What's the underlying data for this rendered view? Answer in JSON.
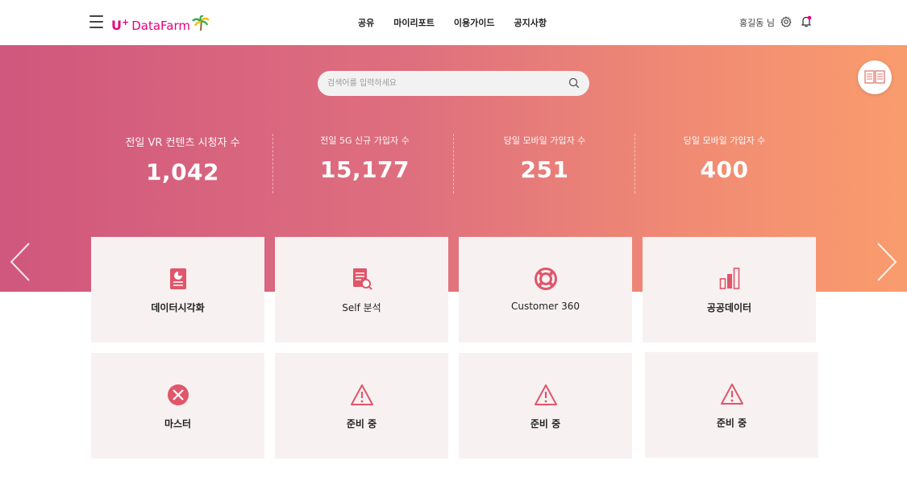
{
  "header": {
    "logo_u": "U",
    "logo_plus": "+",
    "logo_data": "Data",
    "logo_farm": "Farm",
    "nav": [
      "공유",
      "마이리포트",
      "이용가이드",
      "공지사항"
    ],
    "user_label": "홍길동 님"
  },
  "hero": {
    "search_placeholder": "검색어를 입력하세요",
    "stats": [
      {
        "label": "전일 VR 컨텐츠 시청자 수",
        "value": "1,042"
      },
      {
        "label": "전일 5G 신규 가입자 수",
        "value": "15,177"
      },
      {
        "label": "당일 모바일 가입자 수",
        "value": "251"
      },
      {
        "label": "당일 모바일 가입자 수",
        "value": "400"
      }
    ]
  },
  "cards": [
    {
      "title": "데이터시각화",
      "icon": "report-icon"
    },
    {
      "title": "Self 분석",
      "icon": "document-search-icon"
    },
    {
      "title": "Customer 360",
      "icon": "lifebuoy-icon"
    },
    {
      "title": "공공데이터",
      "icon": "bar-chart-icon"
    },
    {
      "title": "마스터",
      "icon": "x-circle-icon"
    },
    {
      "title": "준비 중",
      "icon": "warning-icon"
    },
    {
      "title": "준비 중",
      "icon": "warning-icon"
    },
    {
      "title": "준비 중",
      "icon": "warning-icon"
    }
  ],
  "colors": {
    "brand": "#e6007e",
    "icon_accent": "#e0566a",
    "card_bg": "#f8f1f2"
  }
}
